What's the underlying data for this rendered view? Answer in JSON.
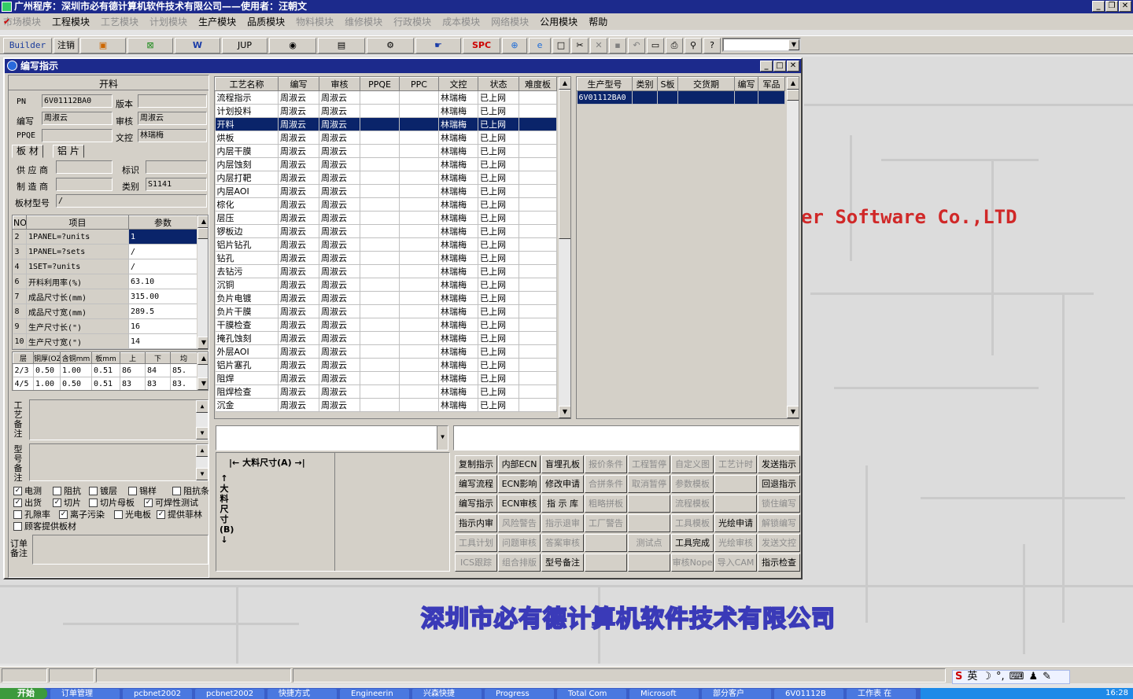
{
  "app": {
    "title": "广州程序：深圳市必有德计算机软件技术有限公司——使用者：汪朝文",
    "window_buttons": [
      "_",
      "❐",
      "✕"
    ]
  },
  "menu": [
    {
      "label": "市场模块",
      "disabled": true
    },
    {
      "label": "工程模块",
      "disabled": false,
      "checked": true
    },
    {
      "label": "工艺模块",
      "disabled": true
    },
    {
      "label": "计划模块",
      "disabled": true
    },
    {
      "label": "生产模块",
      "disabled": false
    },
    {
      "label": "品质模块",
      "disabled": false
    },
    {
      "label": "物料模块",
      "disabled": true
    },
    {
      "label": "维修模块",
      "disabled": true
    },
    {
      "label": "行政模块",
      "disabled": true
    },
    {
      "label": "成本模块",
      "disabled": true
    },
    {
      "label": "网络模块",
      "disabled": true
    },
    {
      "label": "公用模块",
      "disabled": false
    },
    {
      "label": "帮助",
      "disabled": false
    }
  ],
  "toolbar": {
    "builder": "Builder",
    "logout": "注销",
    "jup": "JUP",
    "spc": "SPC",
    "icons": [
      "dialog-icon",
      "excel-icon",
      "word-icon",
      "eye-icon",
      "database-icon",
      "tools-icon",
      "hand-icon",
      "globe-icon",
      "ie-icon",
      "new-icon",
      "cut-icon",
      "delete-icon",
      "save-icon",
      "undo-icon",
      "preview-icon",
      "print-icon",
      "find-icon",
      "help-icon"
    ]
  },
  "watermark": {
    "en": "er Software Co.,LTD",
    "cn": "深圳市必有德计算机软件技术有限公司"
  },
  "dialog": {
    "title": "编写指示",
    "window_buttons": [
      "_",
      "□",
      "✕"
    ],
    "left": {
      "header": "开料",
      "pn_label": "PN",
      "pn_value": "6V01112BA0",
      "version_label": "版本",
      "version_value": "",
      "writer_label": "编写",
      "writer_value": "周淑云",
      "review_label": "审核",
      "review_value": "周淑云",
      "ppqe_label": "PPQE",
      "ppqe_value": "",
      "doc_label": "文控",
      "doc_value": "林瑞梅",
      "tabs": [
        "板 材",
        "铝 片"
      ],
      "supplier_label": "供 应 商",
      "supplier_value": "",
      "mark_label": "标识",
      "mark_value": "",
      "maker_label": "制 造 商",
      "maker_value": "",
      "type_label": "类别",
      "type_value": "S1141",
      "model_label": "板材型号",
      "model_value": "/",
      "param_headers": [
        "NO",
        "项目",
        "参数"
      ],
      "params": [
        [
          "2",
          "1PANEL=?units",
          "1"
        ],
        [
          "3",
          "1PANEL=?sets",
          "/"
        ],
        [
          "4",
          "1SET=?units",
          "/"
        ],
        [
          "6",
          "开料利用率(%)",
          "63.10"
        ],
        [
          "7",
          "成品尺寸长(mm)",
          "315.00"
        ],
        [
          "8",
          "成品尺寸宽(mm)",
          "289.5"
        ],
        [
          "9",
          "生产尺寸长(\")",
          "16"
        ],
        [
          "10",
          "生产尺寸宽(\")",
          "14"
        ]
      ],
      "layer_headers": [
        "层",
        "铜厚(OZ)",
        "含铜mm",
        "板mm",
        "上",
        "下",
        "均"
      ],
      "layers": [
        [
          "2/3",
          "0.50",
          "1.00",
          "0.51",
          "86",
          "84",
          "85."
        ],
        [
          "4/5",
          "1.00",
          "0.50",
          "0.51",
          "83",
          "83",
          "83."
        ]
      ],
      "remark1_label": "工艺备注",
      "remark2_label": "型号备注",
      "checks": [
        {
          "label": "电测",
          "checked": true
        },
        {
          "label": "阻抗",
          "checked": false
        },
        {
          "label": "镀层",
          "checked": false
        },
        {
          "label": "锡样",
          "checked": false
        },
        {
          "label": "阻抗条",
          "checked": false
        },
        {
          "label": "出货",
          "checked": true
        },
        {
          "label": "切片",
          "checked": true
        },
        {
          "label": "切片母板",
          "checked": false
        },
        {
          "label": "可焊性测试",
          "checked": true
        },
        {
          "label": "孔隙率",
          "checked": false
        },
        {
          "label": "离子污染",
          "checked": true
        },
        {
          "label": "光电板",
          "checked": false
        },
        {
          "label": "提供菲林",
          "checked": true
        },
        {
          "label": "顾客提供板材",
          "checked": false
        }
      ],
      "order_remark_label": "订单备注"
    },
    "process": {
      "headers": [
        "工艺名称",
        "编写",
        "审核",
        "PPQE",
        "PPC",
        "文控",
        "状态",
        "难度板"
      ],
      "rows": [
        [
          "流程指示",
          "周淑云",
          "周淑云",
          "",
          "",
          "林瑞梅",
          "已上网",
          ""
        ],
        [
          "计划投料",
          "周淑云",
          "周淑云",
          "",
          "",
          "林瑞梅",
          "已上网",
          ""
        ],
        [
          "开料",
          "周淑云",
          "周淑云",
          "",
          "",
          "林瑞梅",
          "已上网",
          ""
        ],
        [
          "烘板",
          "周淑云",
          "周淑云",
          "",
          "",
          "林瑞梅",
          "已上网",
          ""
        ],
        [
          "内层干膜",
          "周淑云",
          "周淑云",
          "",
          "",
          "林瑞梅",
          "已上网",
          ""
        ],
        [
          "内层蚀刻",
          "周淑云",
          "周淑云",
          "",
          "",
          "林瑞梅",
          "已上网",
          ""
        ],
        [
          "内层打靶",
          "周淑云",
          "周淑云",
          "",
          "",
          "林瑞梅",
          "已上网",
          ""
        ],
        [
          "内层AOI",
          "周淑云",
          "周淑云",
          "",
          "",
          "林瑞梅",
          "已上网",
          ""
        ],
        [
          "棕化",
          "周淑云",
          "周淑云",
          "",
          "",
          "林瑞梅",
          "已上网",
          ""
        ],
        [
          "层压",
          "周淑云",
          "周淑云",
          "",
          "",
          "林瑞梅",
          "已上网",
          ""
        ],
        [
          "锣板边",
          "周淑云",
          "周淑云",
          "",
          "",
          "林瑞梅",
          "已上网",
          ""
        ],
        [
          "铝片钻孔",
          "周淑云",
          "周淑云",
          "",
          "",
          "林瑞梅",
          "已上网",
          ""
        ],
        [
          "钻孔",
          "周淑云",
          "周淑云",
          "",
          "",
          "林瑞梅",
          "已上网",
          ""
        ],
        [
          "去钻污",
          "周淑云",
          "周淑云",
          "",
          "",
          "林瑞梅",
          "已上网",
          ""
        ],
        [
          "沉铜",
          "周淑云",
          "周淑云",
          "",
          "",
          "林瑞梅",
          "已上网",
          ""
        ],
        [
          "负片电镀",
          "周淑云",
          "周淑云",
          "",
          "",
          "林瑞梅",
          "已上网",
          ""
        ],
        [
          "负片干膜",
          "周淑云",
          "周淑云",
          "",
          "",
          "林瑞梅",
          "已上网",
          ""
        ],
        [
          "干膜检查",
          "周淑云",
          "周淑云",
          "",
          "",
          "林瑞梅",
          "已上网",
          ""
        ],
        [
          "掩孔蚀刻",
          "周淑云",
          "周淑云",
          "",
          "",
          "林瑞梅",
          "已上网",
          ""
        ],
        [
          "外层AOI",
          "周淑云",
          "周淑云",
          "",
          "",
          "林瑞梅",
          "已上网",
          ""
        ],
        [
          "铝片塞孔",
          "周淑云",
          "周淑云",
          "",
          "",
          "林瑞梅",
          "已上网",
          ""
        ],
        [
          "阻焊",
          "周淑云",
          "周淑云",
          "",
          "",
          "林瑞梅",
          "已上网",
          ""
        ],
        [
          "阻焊检查",
          "周淑云",
          "周淑云",
          "",
          "",
          "林瑞梅",
          "已上网",
          ""
        ],
        [
          "沉金",
          "周淑云",
          "周淑云",
          "",
          "",
          "林瑞梅",
          "已上网",
          ""
        ]
      ],
      "selected_index": 2
    },
    "product": {
      "headers": [
        "生产型号",
        "类别",
        "S板",
        "交货期",
        "编写",
        "军品"
      ],
      "rows": [
        [
          "6V01112BA0",
          "",
          "",
          "",
          "",
          ""
        ]
      ]
    },
    "material": {
      "width_label": "大料尺寸(A)",
      "height_label": "大料尺寸(B)"
    },
    "buttons": [
      {
        "label": "复制指示",
        "disabled": false
      },
      {
        "label": "内部ECN",
        "disabled": false
      },
      {
        "label": "盲埋孔板",
        "disabled": false
      },
      {
        "label": "报价条件",
        "disabled": true
      },
      {
        "label": "工程暂停",
        "disabled": true
      },
      {
        "label": "自定义图",
        "disabled": true
      },
      {
        "label": "工艺计时",
        "disabled": true
      },
      {
        "label": "发送指示",
        "disabled": false
      },
      {
        "label": "编写流程",
        "disabled": false
      },
      {
        "label": "ECN影响",
        "disabled": false
      },
      {
        "label": "修改申请",
        "disabled": false
      },
      {
        "label": "合拼条件",
        "disabled": true
      },
      {
        "label": "取消暂停",
        "disabled": true
      },
      {
        "label": "参数模板",
        "disabled": true
      },
      {
        "label": "",
        "disabled": true
      },
      {
        "label": "回退指示",
        "disabled": false
      },
      {
        "label": "编写指示",
        "disabled": false
      },
      {
        "label": "ECN审核",
        "disabled": false
      },
      {
        "label": "指 示 库",
        "disabled": false
      },
      {
        "label": "粗略拼板",
        "disabled": true
      },
      {
        "label": "",
        "disabled": true
      },
      {
        "label": "流程模板",
        "disabled": true
      },
      {
        "label": "",
        "disabled": true
      },
      {
        "label": "锁住编写",
        "disabled": true
      },
      {
        "label": "指示内审",
        "disabled": false
      },
      {
        "label": "风险警告",
        "disabled": true
      },
      {
        "label": "指示退审",
        "disabled": true
      },
      {
        "label": "工厂警告",
        "disabled": true
      },
      {
        "label": "",
        "disabled": true
      },
      {
        "label": "工具模板",
        "disabled": true
      },
      {
        "label": "光绘申请",
        "disabled": false
      },
      {
        "label": "解锁编写",
        "disabled": true
      },
      {
        "label": "工具计划",
        "disabled": true
      },
      {
        "label": "问题审核",
        "disabled": true
      },
      {
        "label": "答案审核",
        "disabled": true
      },
      {
        "label": "",
        "disabled": true
      },
      {
        "label": "测试点",
        "disabled": true
      },
      {
        "label": "工具完成",
        "disabled": false
      },
      {
        "label": "光绘审核",
        "disabled": true
      },
      {
        "label": "发送文控",
        "disabled": true
      },
      {
        "label": "ICS跟踪",
        "disabled": true
      },
      {
        "label": "组合排版",
        "disabled": true
      },
      {
        "label": "型号备注",
        "disabled": false
      },
      {
        "label": "",
        "disabled": true
      },
      {
        "label": "",
        "disabled": true
      },
      {
        "label": "审核Nope",
        "disabled": true
      },
      {
        "label": "导入CAM",
        "disabled": true
      },
      {
        "label": "指示检查",
        "disabled": false
      }
    ]
  },
  "taskbar": {
    "start": "开始",
    "tasks": [
      "订单管理",
      "pcbnet2002",
      "pcbnet2002",
      "快捷方式",
      "Engineerin",
      "兴森快捷",
      "Progress",
      "Total Com",
      "Microsoft",
      "部分客户",
      "6V01112B",
      "工作表 在"
    ],
    "clock": "16:28",
    "ime": "英"
  }
}
